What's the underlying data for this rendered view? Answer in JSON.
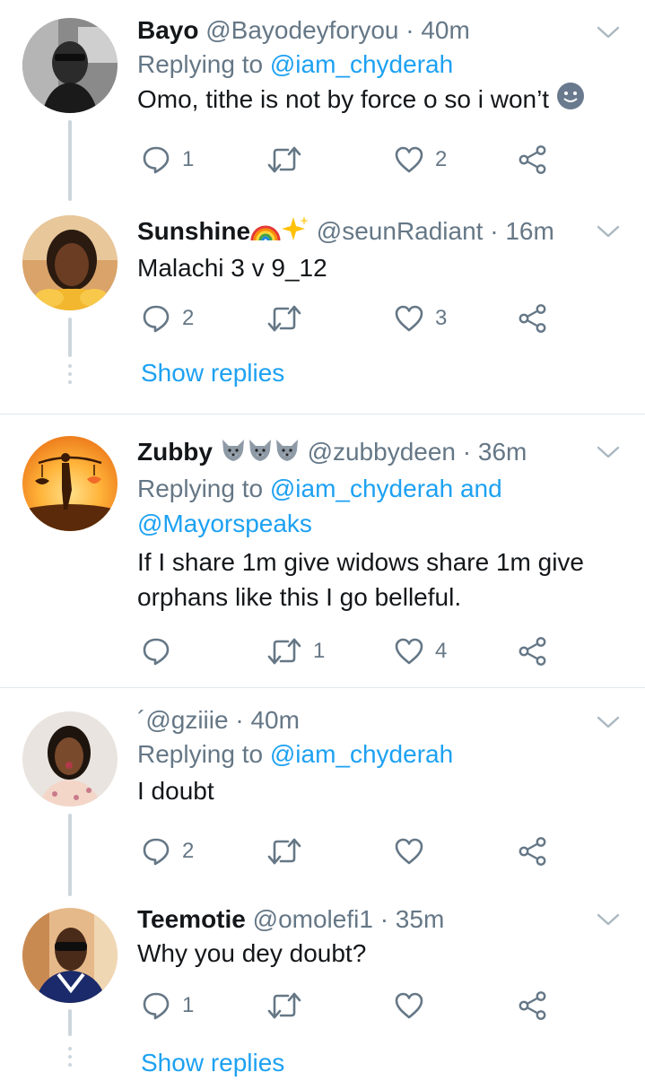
{
  "tweets": [
    {
      "name": "Bayo",
      "handle": "@Bayodeyforyou",
      "separator": "·",
      "time": "40m",
      "replying_prefix": "Replying to ",
      "replying_to": "@iam_chyderah",
      "text": "Omo, tithe is not by force o so i won’t",
      "reply_count": "1",
      "retweet_count": "",
      "like_count": "2"
    },
    {
      "name": "Sunshine",
      "name_emojis": [
        "rainbow-emoji",
        "sparkles-emoji"
      ],
      "handle": "@seunRadiant",
      "separator": "·",
      "time": "16m",
      "text": "Malachi 3 v 9_12",
      "reply_count": "2",
      "retweet_count": "",
      "like_count": "3",
      "show_replies": "Show replies"
    },
    {
      "name": "Zubby",
      "name_emojis": [
        "wolf-emoji",
        "wolf-emoji",
        "wolf-emoji"
      ],
      "handle": "@zubbydeen",
      "separator": "·",
      "time": "36m",
      "replying_prefix": "Replying to ",
      "replying_to": "@iam_chyderah and",
      "replying_to_2": "@Mayorspeaks",
      "text_line1": "If I share 1m give widows share 1m give",
      "text_line2": "orphans like this I go belleful.",
      "reply_count": "",
      "retweet_count": "1",
      "like_count": "4"
    },
    {
      "name": "´",
      "handle": "@gziiie",
      "separator": "·",
      "time": "40m",
      "replying_prefix": "Replying to ",
      "replying_to": "@iam_chyderah",
      "text": "I doubt",
      "reply_count": "2",
      "retweet_count": "",
      "like_count": ""
    },
    {
      "name": "Teemotie",
      "handle": "@omolefi1",
      "separator": "·",
      "time": "35m",
      "text": "Why you dey doubt?",
      "reply_count": "1",
      "retweet_count": "",
      "like_count": "",
      "show_replies": "Show replies"
    }
  ],
  "colors": {
    "primary_text": "#14171a",
    "secondary_text": "#657786",
    "link": "#1da1f2",
    "thread_line": "#ccd6dd",
    "divider": "#e1e8ed"
  },
  "icons": [
    "reply-icon",
    "retweet-icon",
    "like-icon",
    "share-icon",
    "chevron-down-icon"
  ]
}
